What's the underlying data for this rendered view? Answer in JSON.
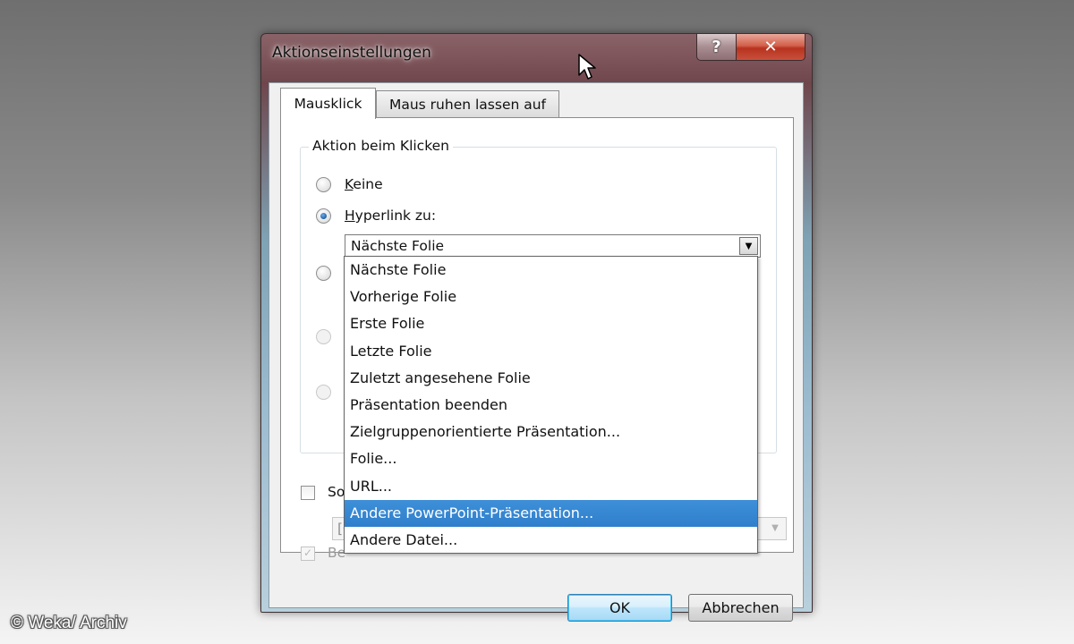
{
  "window": {
    "title": "Aktionseinstellungen",
    "help_label": "?",
    "close_label": "✕"
  },
  "tabs": [
    {
      "label": "Mausklick",
      "active": true
    },
    {
      "label": "Maus ruhen lassen auf",
      "active": false
    }
  ],
  "group": {
    "label": "Aktion beim Klicken",
    "options": [
      {
        "label_key": "K",
        "label_rest": "eine",
        "selected": false
      },
      {
        "label_key": "H",
        "label_rest": "yperlink zu:",
        "selected": true
      }
    ]
  },
  "hyperlink_combo": {
    "value": "Nächste Folie",
    "arrow": "▼"
  },
  "dropdown": {
    "items": [
      "Nächste Folie",
      "Vorherige Folie",
      "Erste Folie",
      "Letzte Folie",
      "Zuletzt angesehene Folie",
      "Präsentation beenden",
      "Zielgruppenorientierte Präsentation...",
      "Folie...",
      "URL...",
      "Andere PowerPoint-Präsentation...",
      "Andere Datei..."
    ],
    "highlighted_index": 9
  },
  "sound": {
    "label_visible": "So",
    "select_text_visible": "[O",
    "arrow": "▼"
  },
  "highlight": {
    "label_visible": "Be",
    "checked": true
  },
  "buttons": {
    "ok": "OK",
    "cancel": "Abbrechen"
  },
  "watermark": "© Weka/ Archiv",
  "colors": {
    "selection": "#3399ff",
    "titlebar": "#6f464c",
    "close_button": "#c8513c"
  }
}
